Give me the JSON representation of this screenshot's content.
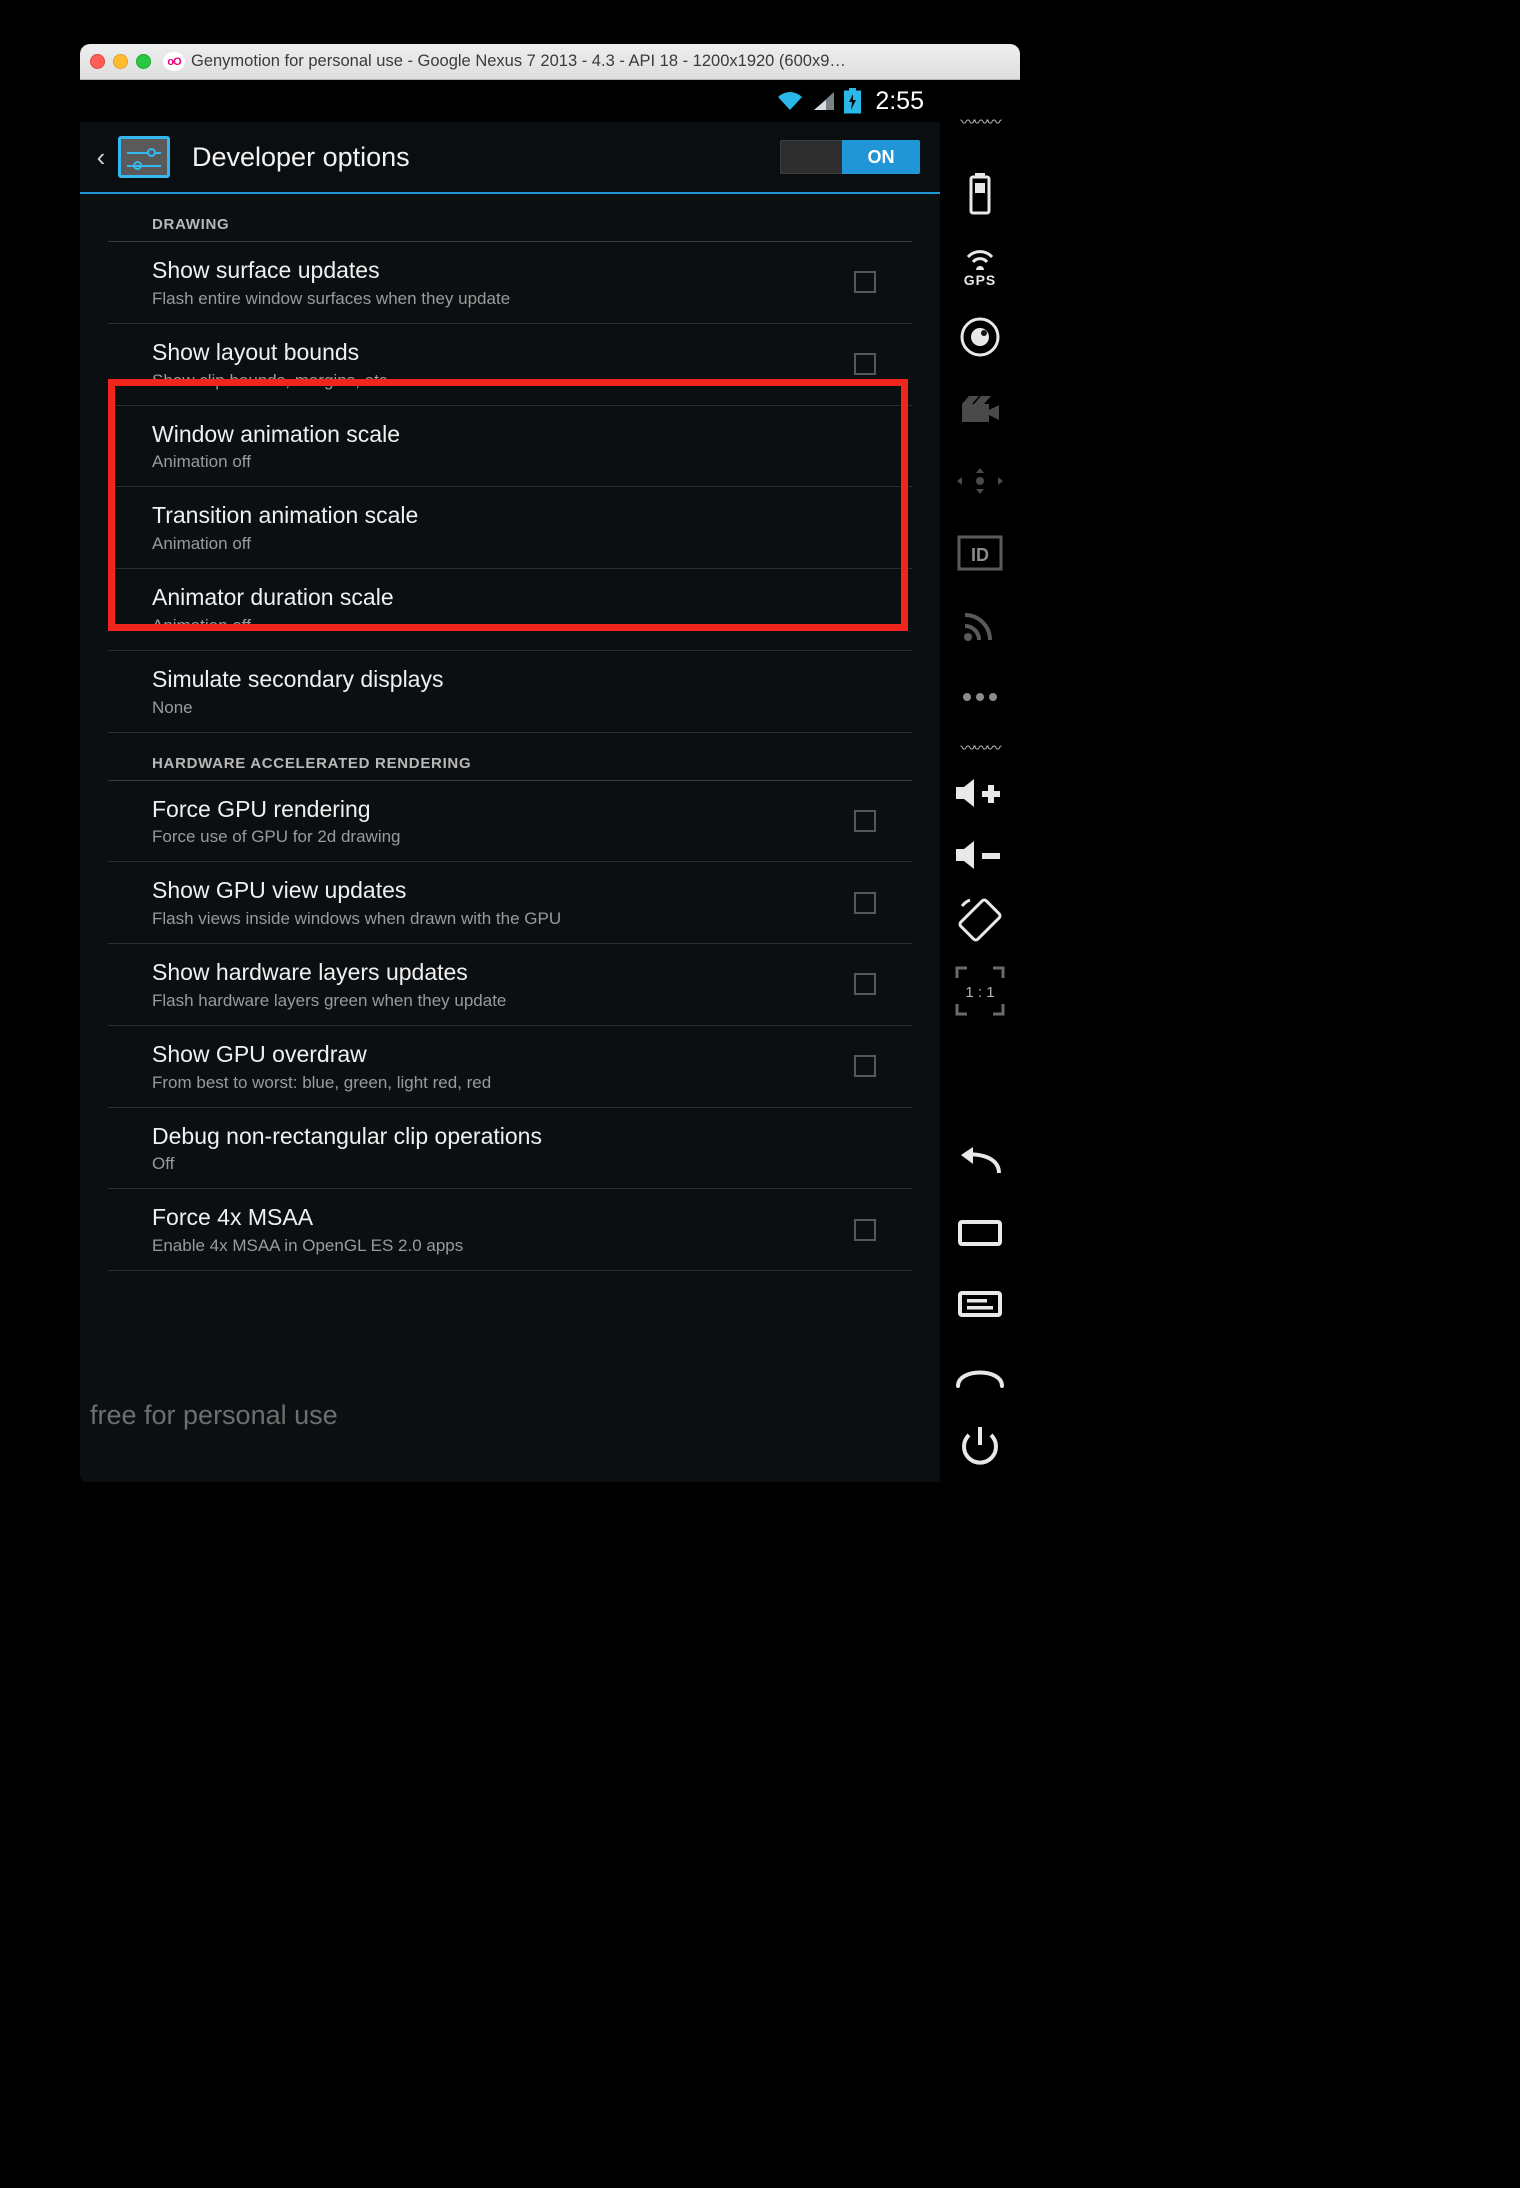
{
  "window": {
    "title": "Genymotion for personal use - Google Nexus 7 2013 - 4.3 - API 18 - 1200x1920 (600x9…",
    "logo_text": "oO",
    "traffic_lights": [
      "close",
      "minimize",
      "maximize"
    ]
  },
  "status_bar": {
    "clock": "2:55",
    "icons": [
      "wifi-icon",
      "signal-icon",
      "battery-icon"
    ]
  },
  "action_bar": {
    "back_label": "‹",
    "title": "Developer options",
    "switch_label": "ON",
    "switch_state": "on",
    "accent_color": "#2196d6"
  },
  "highlight": {
    "color": "#f0261c",
    "covers": [
      "Window animation scale",
      "Transition animation scale",
      "Animator duration scale"
    ]
  },
  "sections": [
    {
      "header": "DRAWING",
      "rows": [
        {
          "title": "Show surface updates",
          "sub": "Flash entire window surfaces when they update",
          "control": "checkbox",
          "checked": false
        },
        {
          "title": "Show layout bounds",
          "sub": "Show clip bounds, margins, etc.",
          "control": "checkbox",
          "checked": false
        },
        {
          "title": "Window animation scale",
          "sub": "Animation off",
          "control": "none",
          "checked": false
        },
        {
          "title": "Transition animation scale",
          "sub": "Animation off",
          "control": "none",
          "checked": false
        },
        {
          "title": "Animator duration scale",
          "sub": "Animation off",
          "control": "none",
          "checked": false
        },
        {
          "title": "Simulate secondary displays",
          "sub": "None",
          "control": "none",
          "checked": false
        }
      ]
    },
    {
      "header": "HARDWARE ACCELERATED RENDERING",
      "rows": [
        {
          "title": "Force GPU rendering",
          "sub": "Force use of GPU for 2d drawing",
          "control": "checkbox",
          "checked": false
        },
        {
          "title": "Show GPU view updates",
          "sub": "Flash views inside windows when drawn with the GPU",
          "control": "checkbox",
          "checked": false
        },
        {
          "title": "Show hardware layers updates",
          "sub": "Flash hardware layers green when they update",
          "control": "checkbox",
          "checked": false
        },
        {
          "title": "Show GPU overdraw",
          "sub": "From best to worst: blue, green, light red, red",
          "control": "checkbox",
          "checked": false
        },
        {
          "title": "Debug non-rectangular clip operations",
          "sub": "Off",
          "control": "none",
          "checked": false
        },
        {
          "title": "Force 4x MSAA",
          "sub": "Enable 4x MSAA in OpenGL ES 2.0 apps",
          "control": "checkbox",
          "checked": false
        }
      ]
    }
  ],
  "nav_bar": {
    "buttons": [
      "back-nav-icon",
      "home-nav-icon",
      "recents-nav-icon"
    ]
  },
  "genymotion_toolbar": {
    "items": [
      {
        "name": "battery-widget-icon",
        "label": ""
      },
      {
        "name": "gps-icon",
        "label": "GPS"
      },
      {
        "name": "camera-icon",
        "label": ""
      },
      {
        "name": "video-recorder-icon",
        "label": ""
      },
      {
        "name": "accelerometer-icon",
        "label": ""
      },
      {
        "name": "identifiers-icon",
        "label": "ID"
      },
      {
        "name": "network-signal-icon",
        "label": ""
      },
      {
        "name": "more-options-icon",
        "label": ""
      },
      {
        "name": "display-squiggle-icon",
        "label": ""
      },
      {
        "name": "volume-up-icon",
        "label": ""
      },
      {
        "name": "volume-down-icon",
        "label": ""
      },
      {
        "name": "rotate-screen-icon",
        "label": ""
      },
      {
        "name": "zoom-one-to-one-icon",
        "label": "1 : 1"
      },
      {
        "name": "back-icon",
        "label": ""
      },
      {
        "name": "recents-icon",
        "label": ""
      },
      {
        "name": "menu-icon",
        "label": ""
      },
      {
        "name": "home-icon",
        "label": ""
      },
      {
        "name": "power-icon",
        "label": ""
      }
    ]
  },
  "watermark": {
    "text": "free for personal use"
  }
}
